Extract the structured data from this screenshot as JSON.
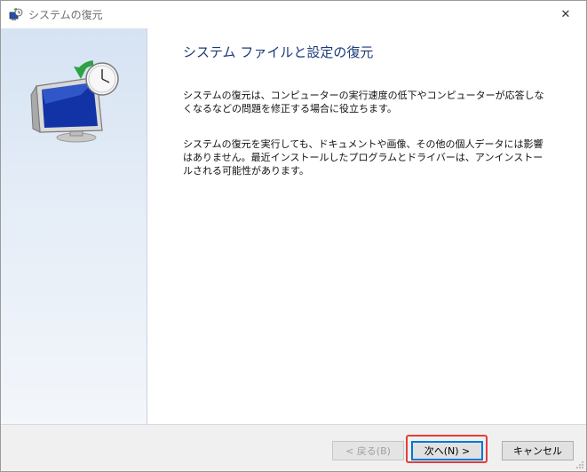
{
  "window": {
    "title": "システムの復元",
    "close_glyph": "✕"
  },
  "content": {
    "heading": "システム ファイルと設定の復元",
    "paragraph1": "システムの復元は、コンピューターの実行速度の低下やコンピューターが応答しなくなるなどの問題を修正する場合に役立ちます。",
    "paragraph2": "システムの復元を実行しても、ドキュメントや画像、その他の個人データには影響はありません。最近インストールしたプログラムとドライバーは、アンインストールされる可能性があります。"
  },
  "footer": {
    "back_label": "< 戻る(B)",
    "next_label": "次へ(N) >",
    "cancel_label": "キャンセル"
  },
  "icons": {
    "title": "system-restore-icon",
    "hero": "system-restore-monitor-clock-icon"
  },
  "colors": {
    "heading": "#1b3a79",
    "highlight": "#e0403a",
    "sidebar_top": "#d6e3f3"
  }
}
